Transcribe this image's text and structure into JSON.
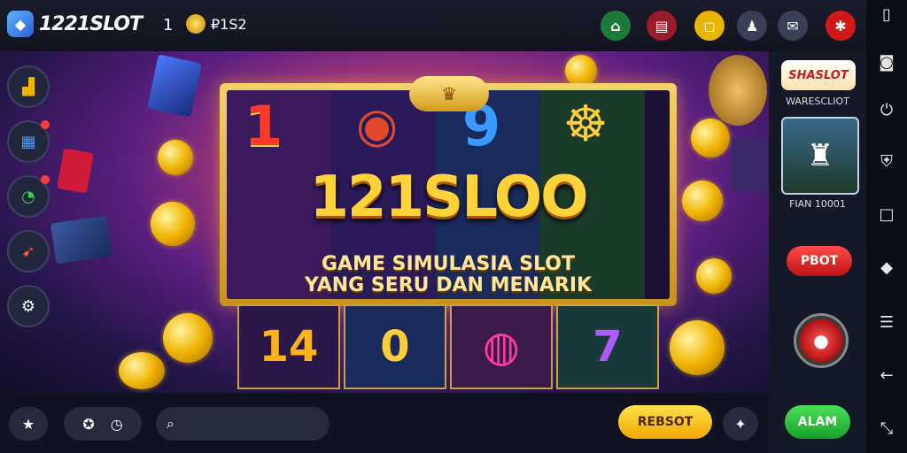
{
  "header": {
    "app_name": "1221SLOT",
    "level": "1",
    "coins": "₽1S2",
    "buttons": [
      {
        "name": "home-icon",
        "glyph": "⌂",
        "bg": "#1c7a3a"
      },
      {
        "name": "book-icon",
        "glyph": "▤",
        "bg": "#9a1c2a"
      },
      {
        "name": "box-icon",
        "glyph": "◻",
        "bg": "#e8b400"
      },
      {
        "name": "person-icon",
        "glyph": "♟",
        "bg": "#3a3f55"
      },
      {
        "name": "mail-icon",
        "glyph": "✉",
        "bg": "#3a3f55"
      },
      {
        "name": "flag-icon",
        "glyph": "✱",
        "bg": "#d01a1a"
      }
    ]
  },
  "left_menu": [
    {
      "name": "chart-icon",
      "glyph": "▟",
      "badge": false
    },
    {
      "name": "cards-icon",
      "glyph": "▦",
      "badge": true
    },
    {
      "name": "chat-icon",
      "glyph": "◔",
      "badge": true
    },
    {
      "name": "gift-icon",
      "glyph": "➹",
      "badge": false
    },
    {
      "name": "settings-icon",
      "glyph": "⚙",
      "badge": false
    }
  ],
  "banner": {
    "brand": "121SLOO",
    "tagline_1": "GAME SIMULASIA SLOT",
    "tagline_2": "YANG SERU DAN MENARIK",
    "top_symbols": [
      "1",
      "◉",
      "9",
      "☸"
    ],
    "bottom_symbols": [
      "14",
      "0",
      "◍",
      "7"
    ]
  },
  "right_panel": {
    "logo": "SHASLOT",
    "logo_caption": "WARESCLIOT",
    "thumb_caption": "FIAN 10001",
    "play_button": "PBOT"
  },
  "bottom_bar": {
    "search_placeholder": "",
    "yellow_button": "REBSOT",
    "green_button": "ALAM"
  },
  "system_bar": {
    "icons": [
      "phone-icon",
      "camera-icon",
      "power-icon",
      "shield-icon",
      "square-icon",
      "bell-icon",
      "menu-icon",
      "back-icon",
      "resize-icon"
    ]
  },
  "colors": {
    "accent": "#ffd23a",
    "danger": "#e01e1e",
    "success": "#1fb030"
  }
}
